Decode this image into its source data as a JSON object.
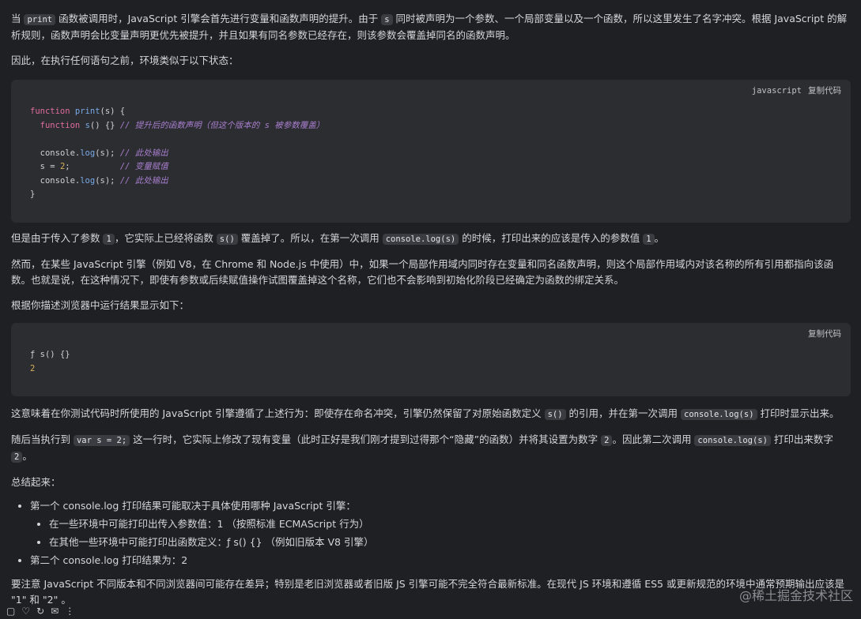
{
  "p1": {
    "a": "当 ",
    "code1": "print",
    "b": " 函数被调用时，JavaScript 引擎会首先进行变量和函数声明的提升。由于 ",
    "code2": "s",
    "c": " 同时被声明为一个参数、一个局部变量以及一个函数，所以这里发生了名字冲突。根据 JavaScript 的解析规则，函数声明会比变量声明更优先被提升，并且如果有同名参数已经存在，则该参数会覆盖掉同名的函数声明。"
  },
  "p2": "因此，在执行任何语句之前，环境类似于以下状态：",
  "code_block_1": {
    "lang": "javascript",
    "copy": "复制代码",
    "l1_kw": "function",
    "l1_fn": "print",
    "l1_rest": "(s) {",
    "l2_kw": "function",
    "l2_fn": "s",
    "l2_rest": "() {} ",
    "l2_cm": "// 提升后的函数声明（但这个版本的 s 被参数覆盖）",
    "l4_a": "console.",
    "l4_fn": "log",
    "l4_b": "(s); ",
    "l4_cm": "// 此处输出",
    "l5_a": "s = ",
    "l5_nm": "2",
    "l5_b": ";          ",
    "l5_cm": "// 变量赋值",
    "l6_a": "console.",
    "l6_fn": "log",
    "l6_b": "(s); ",
    "l6_cm": "// 此处输出",
    "l7": "}"
  },
  "p3": {
    "a": "但是由于传入了参数 ",
    "code1": "1",
    "b": "，它实际上已经将函数 ",
    "code2": "s()",
    "c": " 覆盖掉了。所以，在第一次调用 ",
    "code3": "console.log(s)",
    "d": " 的时候，打印出来的应该是传入的参数值 ",
    "code4": "1",
    "e": "。"
  },
  "p4": "然而，在某些 JavaScript 引擎（例如 V8，在 Chrome 和 Node.js 中使用）中，如果一个局部作用域内同时存在变量和同名函数声明，则这个局部作用域内对该名称的所有引用都指向该函数。也就是说，在这种情况下，即使有参数或后续赋值操作试图覆盖掉这个名称，它们也不会影响到初始化阶段已经确定为函数的绑定关系。",
  "p5": "根据你描述浏览器中运行结果显示如下：",
  "code_block_2": {
    "copy": "复制代码",
    "l1": "ƒ s() {}",
    "l2": "2"
  },
  "p6": {
    "a": "这意味着在你测试代码时所使用的 JavaScript 引擎遵循了上述行为：即使存在命名冲突，引擎仍然保留了对原始函数定义 ",
    "code1": "s()",
    "b": " 的引用，并在第一次调用 ",
    "code2": "console.log(s)",
    "c": " 打印时显示出来。"
  },
  "p7": {
    "a": "随后当执行到 ",
    "code1": "var s = 2;",
    "b": " 这一行时，它实际上修改了现有变量（此时正好是我们刚才提到过得那个“隐藏”的函数）并将其设置为数字 ",
    "code2": "2",
    "c": "。因此第二次调用 ",
    "code3": "console.log(s)",
    "d": " 打印出来数字 ",
    "code4": "2",
    "e": "。"
  },
  "p8": "总结起来：",
  "list": {
    "item1": "第一个 console.log 打印结果可能取决于具体使用哪种 JavaScript 引擎：",
    "sub1": "在一些环境中可能打印出传入参数值：1 （按照标准 ECMAScript 行为）",
    "sub2": "在其他一些环境中可能打印出函数定义：ƒ s() {} （例如旧版本 V8 引擎）",
    "item2": "第二个 console.log 打印结果为：2"
  },
  "p9": "要注意 JavaScript 不同版本和不同浏览器间可能存在差异；特别是老旧浏览器或者旧版 JS 引擎可能不完全符合最新标准。在现代 JS 环境和遵循 ES5 或更新规范的环境中通常预期输出应该是 \"1\" 和 \"2\" 。",
  "watermark": "@稀土掘金技术社区",
  "toolbar_icons": [
    "copy-icon",
    "thumb-icon",
    "refresh-icon",
    "share-icon",
    "more-icon"
  ]
}
